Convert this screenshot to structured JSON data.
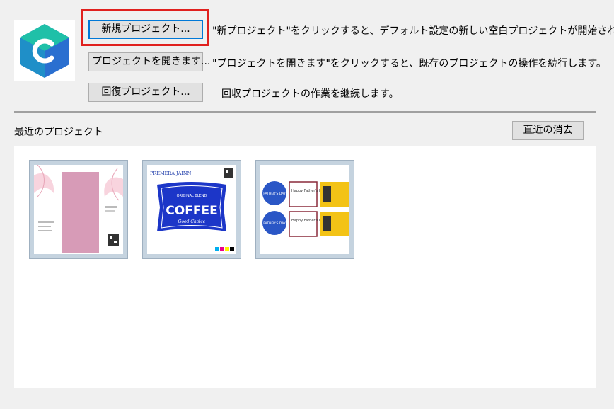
{
  "actions": [
    {
      "button": "新規プロジェクト...",
      "description": "\"新プロジェクト\"をクリックすると、デフォルト設定の新しい空白プロジェクトが開始されます"
    },
    {
      "button": "プロジェクトを開きます...",
      "description": "\"プロジェクトを開きます\"をクリックすると、既存のプロジェクトの操作を続行します。"
    },
    {
      "button": "回復プロジェクト...",
      "description": "回収プロジェクトの作業を継続します。"
    }
  ],
  "recent": {
    "label": "最近のプロジェクト",
    "clear_button": "直近の消去"
  },
  "thumbnails": [
    {
      "name": "pink-leaf-flyer"
    },
    {
      "name": "coffee-label",
      "brand": "PREMERA JAINN",
      "badge": "ORIGINAL BLEND",
      "title": "COFFEE",
      "tagline": "Good Choice"
    },
    {
      "name": "fathers-day-stickers",
      "circle_text": "FATHER'S DAY",
      "card_text": "Happy Father's Day"
    }
  ],
  "colors": {
    "accent": "#0078d7",
    "highlight": "#e0201e",
    "logo_teal": "#19b4a4",
    "logo_blue": "#2a6fd0"
  }
}
